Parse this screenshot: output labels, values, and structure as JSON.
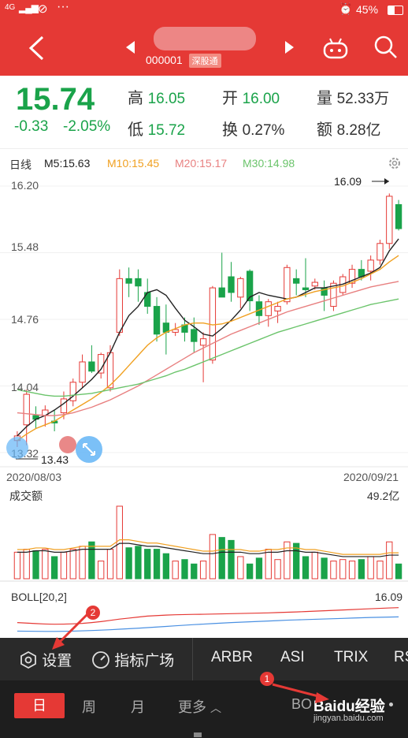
{
  "status_bar": {
    "network": "4G",
    "battery": "45%"
  },
  "nav": {
    "back_icon": "chevron-left-icon",
    "prev_icon": "triangle-left-icon",
    "next_icon": "triangle-right-icon",
    "code": "000001",
    "exchange_tag": "深股通",
    "robot_icon": "robot-icon",
    "search_icon": "search-icon"
  },
  "quote": {
    "price": "15.74",
    "change": "-0.33",
    "change_pct": "-2.05%",
    "high_label": "高",
    "high": "16.05",
    "open_label": "开",
    "open": "16.00",
    "volume_label": "量",
    "volume": "52.33万",
    "low_label": "低",
    "low": "15.72",
    "turnover_label": "换",
    "turnover": "0.27%",
    "amount_label": "额",
    "amount": "8.28亿"
  },
  "kline": {
    "period_label": "日线",
    "ma5": "M5:15.63",
    "ma10": "M10:15.45",
    "ma20": "M20:15.17",
    "ma30": "M30:14.98",
    "y_ticks": [
      "16.20",
      "15.48",
      "14.76",
      "14.04",
      "13.32"
    ],
    "max_label": "16.09",
    "min_label": "13.43",
    "date_start": "2020/08/03",
    "date_end": "2020/09/21"
  },
  "volume_panel": {
    "title": "成交额",
    "max": "49.2亿"
  },
  "boll_panel": {
    "title": "BOLL",
    "params": "[20,2]",
    "value": "16.09"
  },
  "toolbar": {
    "settings": "设置",
    "indicator_plaza": "指标广场",
    "items": [
      "ARBR",
      "ASI",
      "TRIX",
      "RS"
    ]
  },
  "period_bar": {
    "day": "日",
    "week": "周",
    "month": "月",
    "more": "更多",
    "bo": "BO",
    "watermark": "Baidu经验",
    "watermark_url": "jingyan.baidu.com"
  },
  "annotations": [
    "1",
    "2"
  ],
  "colors": {
    "brand_red": "#e53935",
    "down_green": "#1aa34a",
    "ma5": "#222222",
    "ma10": "#f0a020",
    "ma20": "#e88080",
    "ma30": "#6bc46b"
  },
  "chart_data": {
    "type": "candlestick",
    "ylim": [
      13.32,
      16.2
    ],
    "candles": [
      {
        "o": 13.45,
        "h": 13.55,
        "l": 13.38,
        "c": 13.5
      },
      {
        "o": 13.62,
        "h": 14.0,
        "l": 13.4,
        "c": 13.95
      },
      {
        "o": 13.72,
        "h": 13.82,
        "l": 13.58,
        "c": 13.68
      },
      {
        "o": 13.72,
        "h": 13.83,
        "l": 13.6,
        "c": 13.78
      },
      {
        "o": 13.66,
        "h": 13.78,
        "l": 13.55,
        "c": 13.64
      },
      {
        "o": 13.75,
        "h": 13.98,
        "l": 13.68,
        "c": 13.9
      },
      {
        "o": 13.88,
        "h": 14.12,
        "l": 13.82,
        "c": 14.08
      },
      {
        "o": 14.08,
        "h": 14.38,
        "l": 14.02,
        "c": 14.3
      },
      {
        "o": 14.3,
        "h": 14.48,
        "l": 14.18,
        "c": 14.2
      },
      {
        "o": 14.18,
        "h": 14.4,
        "l": 14.12,
        "c": 14.38
      },
      {
        "o": 14.02,
        "h": 14.48,
        "l": 13.98,
        "c": 14.4
      },
      {
        "o": 14.62,
        "h": 15.3,
        "l": 14.58,
        "c": 15.2
      },
      {
        "o": 15.2,
        "h": 15.32,
        "l": 15.0,
        "c": 15.15
      },
      {
        "o": 15.2,
        "h": 15.3,
        "l": 14.95,
        "c": 15.12
      },
      {
        "o": 15.05,
        "h": 15.2,
        "l": 14.82,
        "c": 14.9
      },
      {
        "o": 14.9,
        "h": 15.0,
        "l": 14.52,
        "c": 14.6
      },
      {
        "o": 14.72,
        "h": 14.92,
        "l": 14.38,
        "c": 14.62
      },
      {
        "o": 14.62,
        "h": 14.72,
        "l": 14.58,
        "c": 14.65
      },
      {
        "o": 14.7,
        "h": 14.78,
        "l": 14.52,
        "c": 14.62
      },
      {
        "o": 14.65,
        "h": 14.78,
        "l": 14.4,
        "c": 14.52
      },
      {
        "o": 14.48,
        "h": 14.62,
        "l": 14.08,
        "c": 14.55
      },
      {
        "o": 14.32,
        "h": 15.12,
        "l": 14.28,
        "c": 15.1
      },
      {
        "o": 15.1,
        "h": 15.48,
        "l": 15.02,
        "c": 15.0
      },
      {
        "o": 15.22,
        "h": 15.38,
        "l": 14.95,
        "c": 15.05
      },
      {
        "o": 15.0,
        "h": 15.22,
        "l": 14.88,
        "c": 15.2
      },
      {
        "o": 15.28,
        "h": 15.3,
        "l": 14.85,
        "c": 14.96
      },
      {
        "o": 14.95,
        "h": 15.02,
        "l": 14.7,
        "c": 14.8
      },
      {
        "o": 14.8,
        "h": 14.98,
        "l": 14.68,
        "c": 14.95
      },
      {
        "o": 14.85,
        "h": 14.95,
        "l": 14.72,
        "c": 14.9
      },
      {
        "o": 14.95,
        "h": 15.35,
        "l": 14.92,
        "c": 15.32
      },
      {
        "o": 15.2,
        "h": 15.3,
        "l": 15.02,
        "c": 15.15
      },
      {
        "o": 15.1,
        "h": 15.42,
        "l": 15.0,
        "c": 15.08
      },
      {
        "o": 15.12,
        "h": 15.2,
        "l": 15.08,
        "c": 15.16
      },
      {
        "o": 15.1,
        "h": 15.18,
        "l": 14.85,
        "c": 15.02
      },
      {
        "o": 14.9,
        "h": 15.18,
        "l": 14.85,
        "c": 15.15
      },
      {
        "o": 15.05,
        "h": 15.25,
        "l": 15.02,
        "c": 15.22
      },
      {
        "o": 15.15,
        "h": 15.35,
        "l": 15.1,
        "c": 15.3
      },
      {
        "o": 15.3,
        "h": 15.4,
        "l": 15.18,
        "c": 15.22
      },
      {
        "o": 15.28,
        "h": 15.45,
        "l": 15.18,
        "c": 15.4
      },
      {
        "o": 15.4,
        "h": 15.62,
        "l": 15.35,
        "c": 15.58
      },
      {
        "o": 15.58,
        "h": 16.12,
        "l": 15.52,
        "c": 16.09
      },
      {
        "o": 16.0,
        "h": 16.05,
        "l": 15.72,
        "c": 15.74
      }
    ],
    "ma_lines": {
      "M5": [
        13.5,
        13.6,
        13.68,
        13.72,
        13.78,
        13.85,
        13.93,
        14.02,
        14.11,
        14.22,
        14.4,
        14.62,
        14.8,
        14.9,
        15.05,
        15.08,
        15.02,
        14.88,
        14.75,
        14.68,
        14.6,
        14.58,
        14.66,
        14.75,
        14.86,
        15.0,
        15.05,
        15.02,
        15.0,
        14.98,
        15.0,
        15.05,
        15.1,
        15.1,
        15.12,
        15.14,
        15.18,
        15.22,
        15.26,
        15.32,
        15.5,
        15.63
      ],
      "M10": [
        13.45,
        13.52,
        13.58,
        13.62,
        13.66,
        13.72,
        13.78,
        13.84,
        13.9,
        13.97,
        14.05,
        14.15,
        14.26,
        14.37,
        14.48,
        14.56,
        14.62,
        14.66,
        14.7,
        14.72,
        14.72,
        14.7,
        14.71,
        14.74,
        14.78,
        14.82,
        14.86,
        14.9,
        14.94,
        14.98,
        15.0,
        15.03,
        15.06,
        15.08,
        15.1,
        15.12,
        15.16,
        15.2,
        15.25,
        15.3,
        15.38,
        15.45
      ],
      "M20": [
        13.75,
        13.74,
        13.73,
        13.72,
        13.72,
        13.73,
        13.75,
        13.78,
        13.81,
        13.85,
        13.89,
        13.94,
        13.99,
        14.04,
        14.1,
        14.16,
        14.22,
        14.28,
        14.34,
        14.4,
        14.45,
        14.5,
        14.55,
        14.6,
        14.64,
        14.68,
        14.72,
        14.76,
        14.8,
        14.84,
        14.87,
        14.9,
        14.93,
        14.96,
        14.99,
        15.02,
        15.05,
        15.08,
        15.11,
        15.13,
        15.15,
        15.17
      ],
      "M30": [
        14.0,
        13.98,
        13.96,
        13.94,
        13.93,
        13.93,
        13.94,
        13.95,
        13.96,
        13.98,
        14.0,
        14.02,
        14.04,
        14.06,
        14.09,
        14.12,
        14.15,
        14.19,
        14.22,
        14.26,
        14.3,
        14.34,
        14.38,
        14.42,
        14.46,
        14.5,
        14.54,
        14.58,
        14.62,
        14.65,
        14.68,
        14.71,
        14.74,
        14.77,
        14.8,
        14.83,
        14.86,
        14.89,
        14.92,
        14.94,
        14.96,
        14.98
      ]
    },
    "volume": {
      "ylim": [
        0,
        49.2
      ],
      "values": [
        18,
        20,
        19,
        20,
        15,
        18,
        20,
        22,
        25,
        12,
        20,
        49.2,
        21,
        22,
        20,
        20,
        17,
        12,
        13,
        10,
        12,
        30,
        28,
        26,
        15,
        10,
        14,
        20,
        13,
        25,
        24,
        15,
        18,
        14,
        12,
        13,
        12,
        13,
        15,
        12,
        25,
        10
      ],
      "ma": [
        18,
        18,
        19,
        19,
        18,
        18,
        19,
        20,
        20,
        20,
        20,
        24,
        24,
        23,
        22,
        22,
        21,
        20,
        19,
        18,
        17,
        17,
        18,
        18,
        18,
        17,
        17,
        18,
        18,
        19,
        19,
        18,
        18,
        17,
        16,
        15,
        15,
        15,
        15,
        15,
        16,
        16
      ]
    },
    "boll": {
      "ylim": [
        13.0,
        16.3
      ],
      "upper": [
        14.6,
        14.55,
        14.5,
        14.46,
        14.44,
        14.45,
        14.48,
        14.52,
        14.6,
        14.7,
        14.82,
        14.95,
        15.05,
        15.15,
        15.25,
        15.3,
        15.35,
        15.38,
        15.4,
        15.42,
        15.43,
        15.45,
        15.47,
        15.49,
        15.51,
        15.53,
        15.55,
        15.57,
        15.6,
        15.63,
        15.66,
        15.7,
        15.74,
        15.78,
        15.82,
        15.86,
        15.9,
        15.94,
        15.98,
        16.02,
        16.06,
        16.09
      ],
      "mid": [
        13.75,
        13.74,
        13.73,
        13.72,
        13.72,
        13.73,
        13.75,
        13.78,
        13.81,
        13.85,
        13.89,
        13.94,
        13.99,
        14.04,
        14.1,
        14.16,
        14.22,
        14.28,
        14.34,
        14.4,
        14.45,
        14.5,
        14.55,
        14.6,
        14.64,
        14.68,
        14.72,
        14.76,
        14.8,
        14.84,
        14.87,
        14.9,
        14.93,
        14.96,
        14.99,
        15.02,
        15.05,
        15.08,
        15.11,
        15.13,
        15.15,
        15.17
      ]
    }
  }
}
